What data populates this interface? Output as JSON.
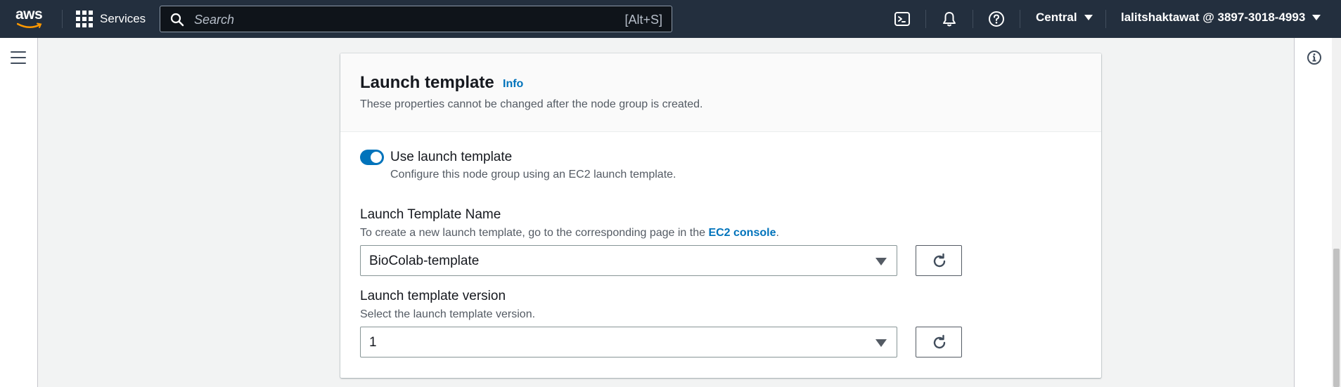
{
  "nav": {
    "logo_text": "aws",
    "services_label": "Services",
    "search_placeholder": "Search",
    "search_shortcut": "[Alt+S]",
    "region_label": "Central",
    "account_label": "lalitshaktawat @ 3897-3018-4993",
    "icons": [
      "cloudshell-icon",
      "bell-icon",
      "help-icon"
    ]
  },
  "section": {
    "title": "Launch template",
    "info_link": "Info",
    "description": "These properties cannot be changed after the node group is created.",
    "toggle": {
      "label": "Use launch template",
      "description": "Configure this node group using an EC2 launch template.",
      "enabled": true
    },
    "template_name": {
      "label": "Launch Template Name",
      "description_prefix": "To create a new launch template, go to the corresponding page in the ",
      "description_link": "EC2 console",
      "description_suffix": ".",
      "selected_value": "BioColab-template"
    },
    "template_version": {
      "label": "Launch template version",
      "description": "Select the launch template version.",
      "selected_value": "1"
    }
  },
  "colors": {
    "nav_bg": "#232f3e",
    "accent": "#0073bb",
    "page_bg": "#f2f3f3"
  }
}
